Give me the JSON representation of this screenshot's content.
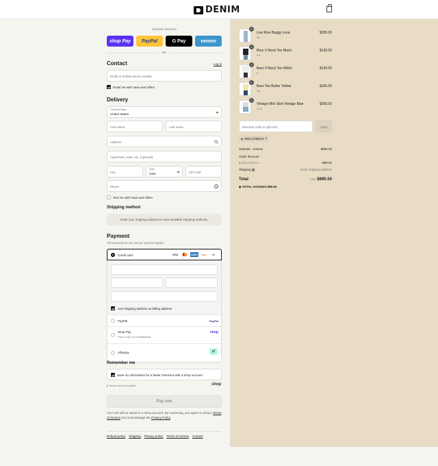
{
  "header": {
    "brand": "DENIM",
    "cart_icon": "shopping-bag-icon"
  },
  "express": {
    "label": "Express checkout",
    "buttons": [
      "shop Pay",
      "PayPal",
      "G Pay",
      "venmo"
    ],
    "or": "OR"
  },
  "contact": {
    "title": "Contact",
    "login": "Log in",
    "email_placeholder": "Email or mobile phone number",
    "news_label": "Email me with news and offers",
    "news_checked": true
  },
  "delivery": {
    "title": "Delivery",
    "country_label": "Country/Region",
    "country_value": "United States",
    "first_name": "First name",
    "last_name": "Last name",
    "address": "Address",
    "apartment": "Apartment, suite, etc. (optional)",
    "city": "City",
    "state_label": "State",
    "state_value": "Iowa",
    "zip": "ZIP code",
    "phone": "Phone",
    "text_label": "Text me with news and offers"
  },
  "shipping": {
    "title": "Shipping method",
    "message": "Enter your shipping address to view available shipping methods."
  },
  "payment": {
    "title": "Payment",
    "subtitle": "All transactions are secure and encrypted.",
    "credit_card": "Credit card",
    "card_brands": [
      "VISA",
      "MC",
      "AMEX",
      "DISC",
      "+4"
    ],
    "billing_label": "Use shipping address as billing address",
    "paypal": "PayPal",
    "shop_pay": "Shop Pay",
    "shop_pay_sub": "Pay in full or in installments",
    "afterpay": "Afterpay",
    "paypal_logo": "PayPal",
    "shop_logo": "shop"
  },
  "remember": {
    "title": "Remember me",
    "save_label": "Save my information for a faster checkout with a Shop account",
    "secure": "Secure and encrypted",
    "shop_logo": "shop"
  },
  "pay_now": "Pay now",
  "legal": {
    "line1": "Your info will be saved to a Shop account. By continuing, you agree to Shop's",
    "terms": "Terms of Service",
    "and": "and acknowledge the",
    "privacy": "Privacy Policy",
    "dot": "."
  },
  "footer_links": [
    "Refund policy",
    "Shipping",
    "Privacy policy",
    "Terms of service",
    "Contact"
  ],
  "order": {
    "items": [
      {
        "name": "Low Rise Baggy Luna",
        "size": "24",
        "price": "$295.00",
        "qty": "1"
      },
      {
        "name": "Baro V-Neck Tee Black",
        "size": "XS",
        "price": "$135.00",
        "qty": "1"
      },
      {
        "name": "Baro V-Neck Tee White",
        "size": "S",
        "price": "$135.00",
        "qty": "1"
      },
      {
        "name": "Baro Tee Butter Yellow",
        "size": "XS",
        "price": "$165.00",
        "qty": "1"
      },
      {
        "name": "Vintage Mini Skirt Vintage Blue",
        "size": "XXS",
        "price": "$265.00",
        "qty": "1"
      }
    ],
    "discount_placeholder": "Discount code or gift card",
    "apply": "Apply",
    "code_chip": "WELCOME10",
    "subtotal_label": "Subtotal · 5 items",
    "subtotal": "$995.00",
    "order_discount": "Order discount",
    "discount_code": "WELCOME10",
    "discount_value": "- $99.50",
    "shipping_label": "Shipping",
    "shipping_value": "Enter shipping address",
    "total_label": "Total",
    "currency": "USD",
    "total": "$895.50",
    "savings_label": "TOTAL SAVINGS",
    "savings": "$99.50"
  }
}
